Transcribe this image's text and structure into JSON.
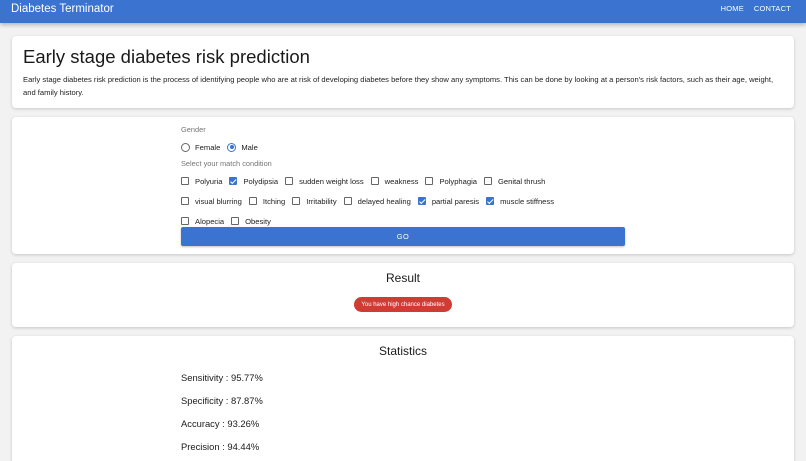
{
  "app": {
    "title": "Diabetes Terminator",
    "nav": [
      "HOME",
      "CONTACT"
    ]
  },
  "intro": {
    "title": "Early stage diabetes risk prediction",
    "description": "Early stage diabetes risk prediction is the process of identifying people who are at risk of developing diabetes before they show any symptoms. This can be done by looking at a person's risk factors, such as their age, weight, and family history."
  },
  "form": {
    "gender_label": "Gender",
    "gender_options": [
      {
        "label": "Female",
        "selected": false
      },
      {
        "label": "Male",
        "selected": true
      }
    ],
    "condition_label": "Select your match condition",
    "conditions": [
      [
        {
          "label": "Polyuria",
          "checked": false
        },
        {
          "label": "Polydipsia",
          "checked": true
        },
        {
          "label": "sudden weight loss",
          "checked": false
        },
        {
          "label": "weakness",
          "checked": false
        },
        {
          "label": "Polyphagia",
          "checked": false
        },
        {
          "label": "Genital thrush",
          "checked": false
        }
      ],
      [
        {
          "label": "visual blurring",
          "checked": false
        },
        {
          "label": "Itching",
          "checked": false
        },
        {
          "label": "Irritability",
          "checked": false
        },
        {
          "label": "delayed healing",
          "checked": false
        },
        {
          "label": "partial paresis",
          "checked": true
        },
        {
          "label": "muscle stiffness",
          "checked": true
        }
      ],
      [
        {
          "label": "Alopecia",
          "checked": false
        },
        {
          "label": "Obesity",
          "checked": false
        }
      ]
    ],
    "submit_label": "GO"
  },
  "result": {
    "title": "Result",
    "badge": "You have high chance diabetes",
    "badge_color": "#d03c33"
  },
  "statistics": {
    "title": "Statistics",
    "items": [
      "Sensitivity : 95.77%",
      "Specificity : 87.87%",
      "Accuracy : 93.26%",
      "Precision : 94.44%"
    ]
  },
  "colors": {
    "primary": "#3a74d0",
    "danger": "#d03c33"
  }
}
